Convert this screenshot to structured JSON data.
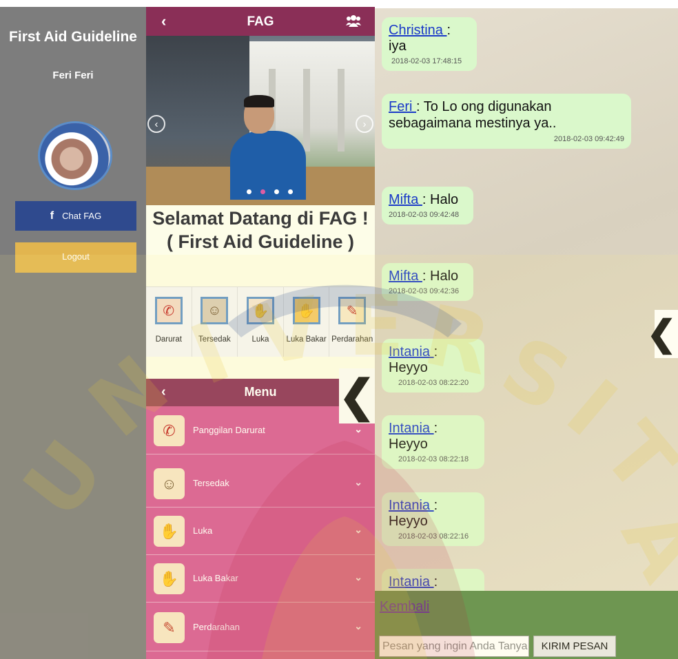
{
  "drawer": {
    "app_title": "First Aid Guideline",
    "user_name": "Feri Feri",
    "chat_button": "Chat FAG",
    "facebook_glyph": "f",
    "logout_button": "Logout",
    "colors": {
      "background": "#7d7d7d",
      "chat": "#2f4a8e",
      "logout": "#e2b54f"
    }
  },
  "home": {
    "appbar": {
      "back": "‹",
      "title": "FAG",
      "group_icon": "users-icon",
      "color": "#8a2f57"
    },
    "carousel": {
      "prev": "‹",
      "next": "›",
      "active_slide": 2,
      "slide_count": 4
    },
    "welcome_line1": "Selamat Datang di FAG !",
    "welcome_line2": "( First Aid Guideline )",
    "categories": [
      {
        "label": "Darurat",
        "icon": "phone-icon",
        "glyph": "✆"
      },
      {
        "label": "Tersedak",
        "icon": "choking-icon",
        "glyph": "☺"
      },
      {
        "label": "Luka",
        "icon": "wound-icon",
        "glyph": "✋"
      },
      {
        "label": "Luka Bakar",
        "icon": "burn-icon",
        "glyph": "✋"
      },
      {
        "label": "Perdarahan",
        "icon": "bleeding-icon",
        "glyph": "✎"
      }
    ],
    "menu": {
      "back": "‹",
      "title": "Menu",
      "color": "#d85895",
      "items": [
        {
          "label": "Panggilan Darurat",
          "icon": "phone-icon",
          "glyph": "✆"
        },
        {
          "label": "Tersedak",
          "icon": "choking-icon",
          "glyph": "☺"
        },
        {
          "label": "Luka",
          "icon": "wound-icon",
          "glyph": "✋"
        },
        {
          "label": "Luka Bakar",
          "icon": "burn-icon",
          "glyph": "✋"
        },
        {
          "label": "Perdarahan",
          "icon": "bleeding-icon",
          "glyph": "✎"
        }
      ],
      "chevron": "⌄"
    },
    "slide_handle": "❮"
  },
  "chat": {
    "messages": [
      {
        "sender": "Christina ",
        "text": ": iya",
        "time": "2018-02-03 17:48:15"
      },
      {
        "sender": "Feri ",
        "text": ": To Lo ong digunakan sebagaimana mestinya ya..",
        "time": "2018-02-03 09:42:49"
      },
      {
        "sender": "Mifta ",
        "text": ": Halo",
        "time": "2018-02-03 09:42:48"
      },
      {
        "sender": "Mifta ",
        "text": ": Halo",
        "time": "2018-02-03 09:42:36"
      },
      {
        "sender": "Intania ",
        "text": ": Heyyo",
        "time": "2018-02-03 08:22:20"
      },
      {
        "sender": "Intania ",
        "text": ": Heyyo",
        "time": "2018-02-03 08:22:18"
      },
      {
        "sender": "Intania ",
        "text": ": Heyyo",
        "time": "2018-02-03 08:22:16"
      },
      {
        "sender": "Intania ",
        "text": ": Heyyo",
        "time": ""
      }
    ],
    "back_link": "Kembali",
    "input_placeholder": "Pesan yang ingin Anda Tanya",
    "send_button": "KIRIM PESAN",
    "side_handle": "❮",
    "colors": {
      "bubble": "#daf8cb",
      "footer": "#5a8a49"
    }
  },
  "watermark": "UNIVERSITAS"
}
